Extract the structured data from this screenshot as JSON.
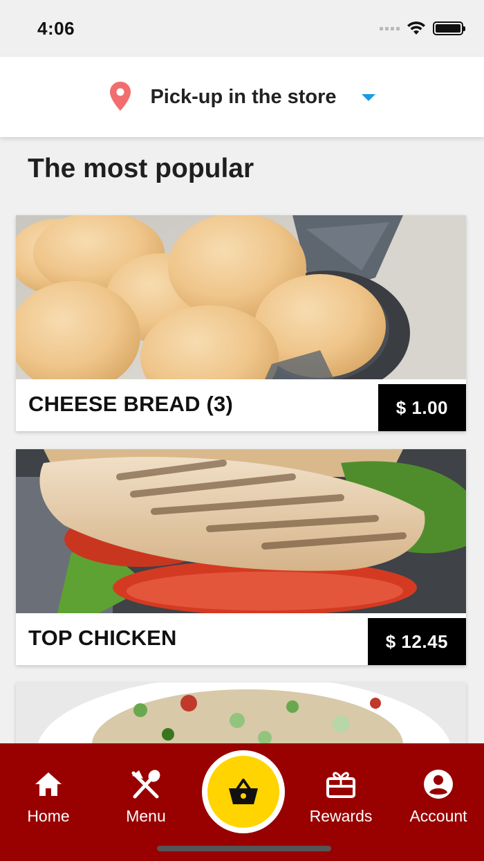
{
  "status_bar": {
    "time": "4:06"
  },
  "pickup": {
    "label": "Pick-up in the store"
  },
  "section": {
    "title": "The most popular"
  },
  "products": [
    {
      "name": "CHEESE BREAD (3)",
      "price": "$ 1.00"
    },
    {
      "name": "TOP CHICKEN",
      "price": "$ 12.45"
    },
    {
      "name": "",
      "price": ""
    }
  ],
  "nav": {
    "home": "Home",
    "menu": "Menu",
    "rewards": "Rewards",
    "account": "Account"
  },
  "colors": {
    "nav_background": "#990000",
    "basket_accent": "#ffd400",
    "pin": "#f26d6d",
    "caret": "#1d9be0"
  },
  "icons": [
    "location-pin-icon",
    "dropdown-caret-icon",
    "home-icon",
    "utensils-icon",
    "basket-icon",
    "gift-icon",
    "account-icon"
  ]
}
